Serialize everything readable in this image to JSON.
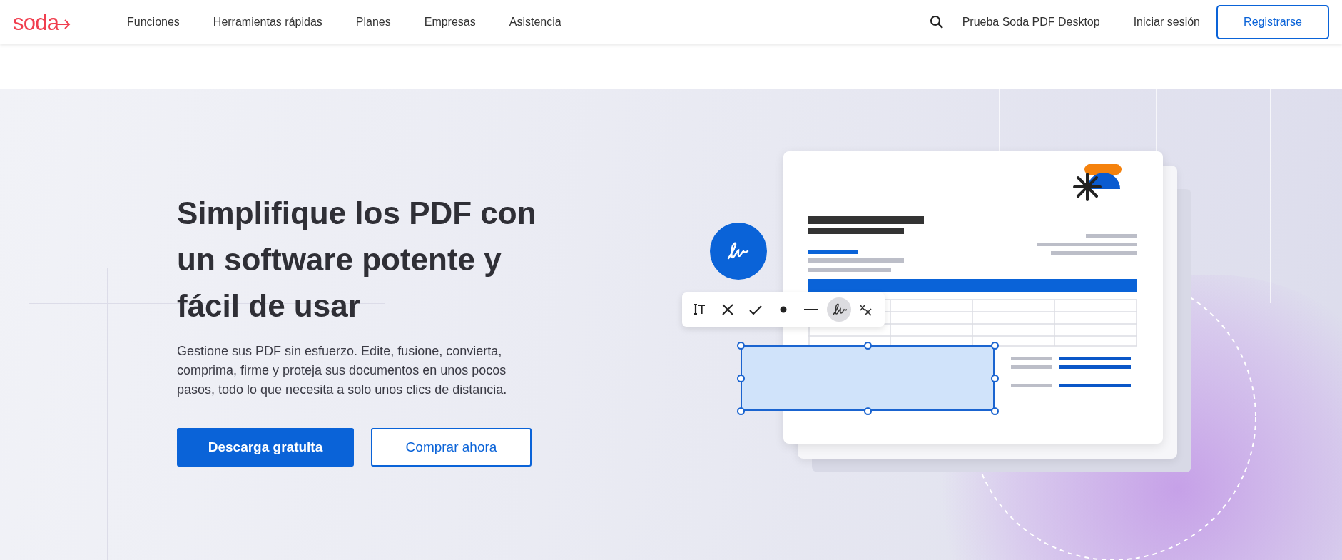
{
  "header": {
    "logo": "soda",
    "nav": [
      "Funciones",
      "Herramientas rápidas",
      "Planes",
      "Empresas",
      "Asistencia"
    ],
    "desktop_link": "Prueba Soda PDF Desktop",
    "login": "Iniciar sesión",
    "register": "Registrarse"
  },
  "hero": {
    "title": "Simplifique los PDF con un software potente y fácil de usar",
    "description": "Gestione sus PDF sin esfuerzo. Edite, fusione, convierta, comprima, firme y proteja sus documentos en unos pocos pasos, todo lo que necesita a solo unos clics de distancia.",
    "buttons": [
      {
        "label": "Descarga gratuita",
        "kind": "primary"
      },
      {
        "label": "Comprar ahora",
        "kind": "secondary"
      }
    ]
  },
  "toolbar": [
    {
      "kind": "text",
      "selected": false
    },
    {
      "kind": "cross",
      "selected": false
    },
    {
      "kind": "check",
      "selected": false
    },
    {
      "kind": "dot",
      "selected": false
    },
    {
      "kind": "line",
      "selected": false
    },
    {
      "kind": "signature",
      "selected": true
    },
    {
      "kind": "clear",
      "selected": false
    }
  ]
}
